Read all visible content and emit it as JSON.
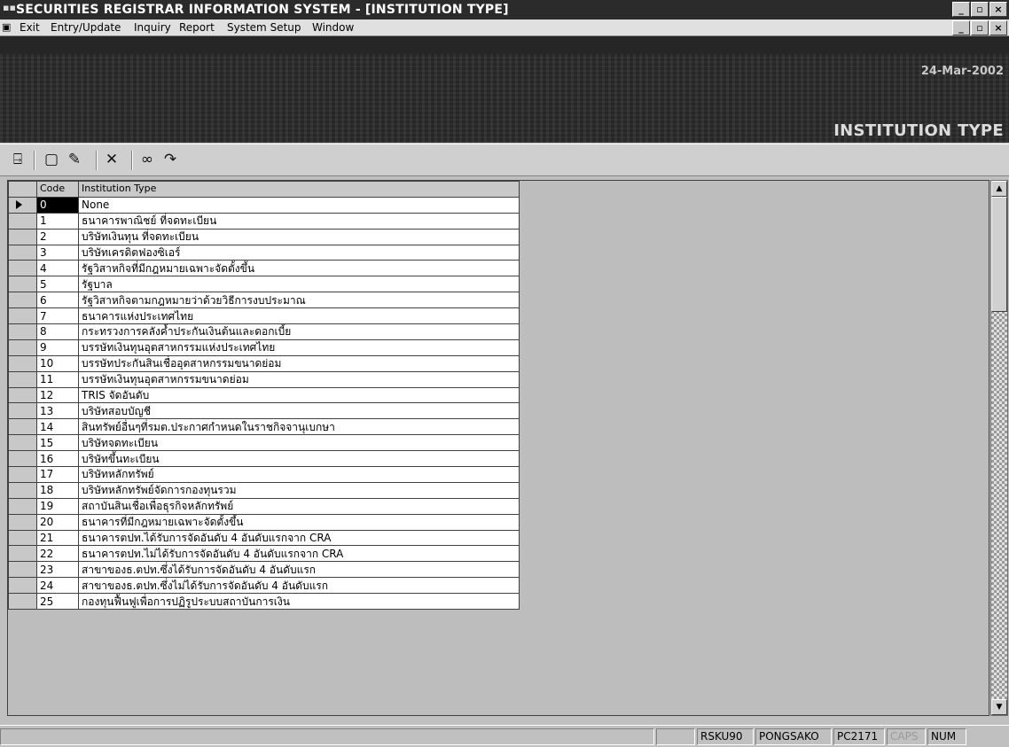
{
  "window": {
    "title": "SECURITIES REGISTRAR INFORMATION SYSTEM - [INSTITUTION TYPE]",
    "controls": [
      "_",
      "▫",
      "×"
    ]
  },
  "menu": {
    "items": [
      {
        "label": "Exit"
      },
      {
        "label": "Entry/Update"
      },
      {
        "label": "Inquiry"
      },
      {
        "label": "Report"
      },
      {
        "label": "System Setup"
      },
      {
        "label": "Window"
      }
    ]
  },
  "banner": {
    "date": "24-Mar-2002",
    "screen_title": "INSTITUTION TYPE"
  },
  "toolbar": {
    "icons": [
      "exit-door-icon",
      "new-record-icon",
      "edit-pencil-icon",
      "delete-x-icon",
      "find-binoculars-icon",
      "find-next-arrow-icon"
    ]
  },
  "grid": {
    "columns": [
      "Code",
      "Institution Type"
    ],
    "selected_row": 0,
    "rows": [
      {
        "code": "0",
        "name": "None"
      },
      {
        "code": "1",
        "name": "ธนาคารพาณิชย์ ที่จดทะเบียน"
      },
      {
        "code": "2",
        "name": "บริษัทเงินทุน ที่จดทะเบียน"
      },
      {
        "code": "3",
        "name": "บริษัทเครดิตฟองซิเอร์"
      },
      {
        "code": "4",
        "name": "รัฐวิสาหกิจที่มีกฎหมายเฉพาะจัดตั้งขึ้น"
      },
      {
        "code": "5",
        "name": "รัฐบาล"
      },
      {
        "code": "6",
        "name": "รัฐวิสาหกิจตามกฎหมายว่าด้วยวิธีการงบประมาณ"
      },
      {
        "code": "7",
        "name": "ธนาคารแห่งประเทศไทย"
      },
      {
        "code": "8",
        "name": "กระทรวงการคลังค้ำประกันเงินต้นและดอกเบี้ย"
      },
      {
        "code": "9",
        "name": "บรรษัทเงินทุนอุตสาหกรรมแห่งประเทศไทย"
      },
      {
        "code": "10",
        "name": "บรรษัทประกันสินเชื่ออุตสาหกรรมขนาดย่อม"
      },
      {
        "code": "11",
        "name": "บรรษัทเงินทุนอุตสาหกรรมขนาดย่อม"
      },
      {
        "code": "12",
        "name": "TRIS จัดอันดับ"
      },
      {
        "code": "13",
        "name": "บริษัทสอบบัญชี"
      },
      {
        "code": "14",
        "name": "สินทรัพย์อื่นๆที่รมต.ประกาศกำหนดในราชกิจจานุเบกษา"
      },
      {
        "code": "15",
        "name": "บริษัทจดทะเบียน"
      },
      {
        "code": "16",
        "name": "บริษัทขึ้นทะเบียน"
      },
      {
        "code": "17",
        "name": "บริษัทหลักทรัพย์"
      },
      {
        "code": "18",
        "name": "บริษัทหลักทรัพย์จัดการกองทุนรวม"
      },
      {
        "code": "19",
        "name": "สถาบันสินเชื่อเพื่อธุรกิจหลักทรัพย์"
      },
      {
        "code": "20",
        "name": "ธนาคารที่มีกฎหมายเฉพาะจัดตั้งขึ้น"
      },
      {
        "code": "21",
        "name": "ธนาคารตปท.ได้รับการจัดอันดับ 4 อันดับแรกจาก CRA"
      },
      {
        "code": "22",
        "name": "ธนาคารตปท.ไม่ได้รับการจัดอันดับ 4 อันดับแรกจาก CRA"
      },
      {
        "code": "23",
        "name": "สาขาของธ.ตปท.ซึ่งได้รับการจัดอันดับ 4 อันดับแรก"
      },
      {
        "code": "24",
        "name": "สาขาของธ.ตปท.ซึ่งไม่ได้รับการจัดอันดับ 4 อันดับแรก"
      },
      {
        "code": "25",
        "name": "กองทุนฟื้นฟูเพื่อการปฏิรูประบบสถาบันการเงิน"
      }
    ]
  },
  "status": {
    "panels": [
      "RSKU90",
      "PONGSAKO",
      "PC2171",
      "CAPS",
      "NUM"
    ]
  }
}
